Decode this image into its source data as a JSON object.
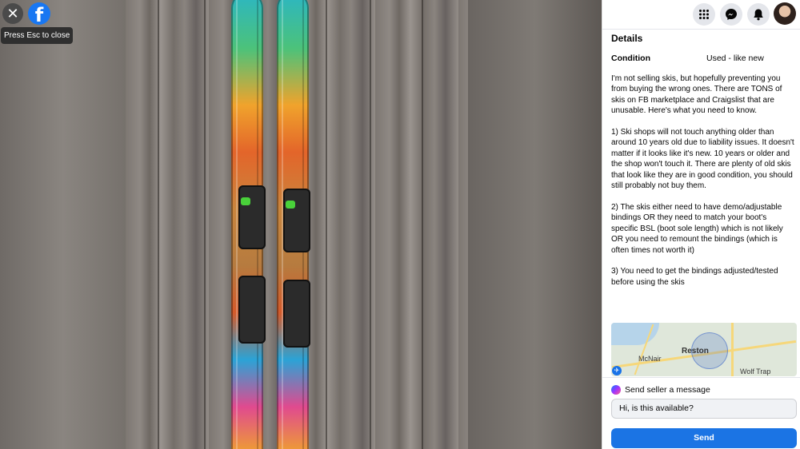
{
  "viewer": {
    "close_icon": "close-icon",
    "logo_icon": "facebook-logo",
    "logo_glyph": "f",
    "esc_tooltip": "Press Esc to close"
  },
  "topbar": {
    "icons": [
      "menu-grid-icon",
      "messenger-icon",
      "notifications-bell-icon",
      "account-avatar"
    ]
  },
  "details": {
    "title": "Details",
    "condition_label": "Condition",
    "condition_value": "Used - like new",
    "description": "I'm not selling skis, but hopefully preventing you from buying the wrong ones. There are TONS of skis on FB marketplace and Craigslist that are unusable. Here's what you need to know.\n\n1) Ski shops will not touch anything older than around 10 years old due to liability issues. It doesn't matter if it looks like it's new. 10 years or older and the shop won't touch it. There are plenty of old skis that look like they are in good condition, you should still probably not buy them.\n\n2) The skis either need to have demo/adjustable bindings OR they need to match your boot's specific BSL (boot sole length) which is not likely OR you need to remount the bindings (which is often times not worth it)\n\n3) You need to get the bindings adjusted/tested before using the skis"
  },
  "map": {
    "labels": [
      "Reston",
      "McNair",
      "Wolf Trap"
    ]
  },
  "message": {
    "header": "Send seller a message",
    "input_value": "Hi, is this available?",
    "send_label": "Send"
  },
  "colors": {
    "accent": "#1b74e4",
    "facebook_blue": "#1877f2"
  }
}
